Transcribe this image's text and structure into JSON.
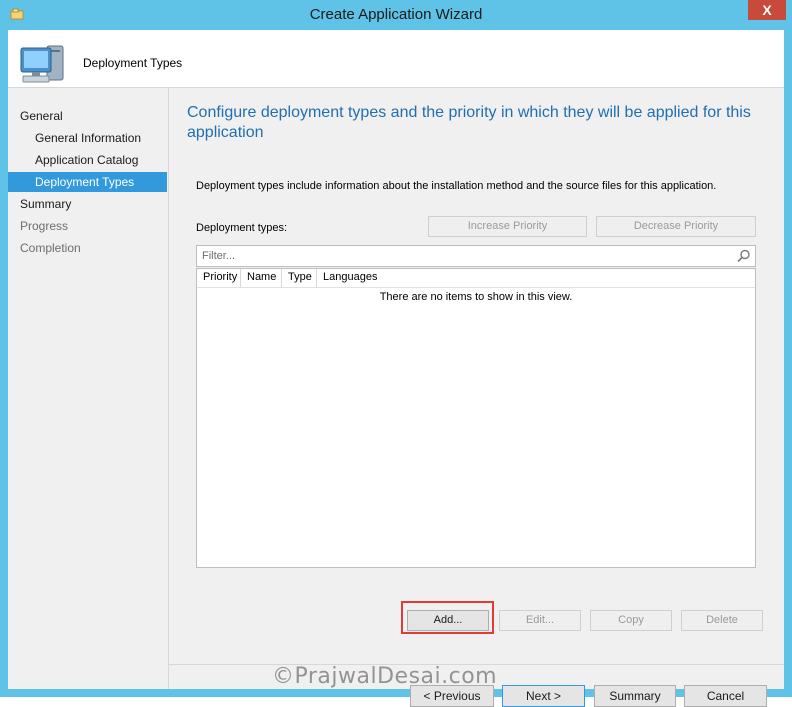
{
  "window": {
    "title": "Create Application Wizard",
    "close_glyph": "X"
  },
  "header": {
    "title": "Deployment Types",
    "icon": "computer-icon"
  },
  "nav": {
    "items": [
      {
        "label": "General"
      },
      {
        "label": "General Information"
      },
      {
        "label": "Application Catalog"
      },
      {
        "label": "Deployment Types",
        "selected": true
      },
      {
        "label": "Summary"
      },
      {
        "label": "Progress"
      },
      {
        "label": "Completion"
      }
    ]
  },
  "main": {
    "heading": "Configure deployment types and the priority in which they will be applied for this application",
    "description": "Deployment types include information about the installation method and the source files for this application.",
    "deployment_types_label": "Deployment types:",
    "increase_priority": "Increase Priority",
    "decrease_priority": "Decrease Priority",
    "filter_placeholder": "Filter...",
    "columns": [
      "Priority",
      "Name",
      "Type",
      "Languages"
    ],
    "empty_message": "There are no items to show in this view.",
    "add": "Add...",
    "edit": "Edit...",
    "copy": "Copy",
    "delete": "Delete"
  },
  "footer": {
    "previous": "< Previous",
    "next": "Next >",
    "summary": "Summary",
    "cancel": "Cancel"
  },
  "watermark": "©PrajwalDesai.com",
  "colors": {
    "accent": "#3399dd",
    "heading": "#1f6fb2",
    "frame": "#5fc3e8",
    "highlight": "#e53935"
  }
}
